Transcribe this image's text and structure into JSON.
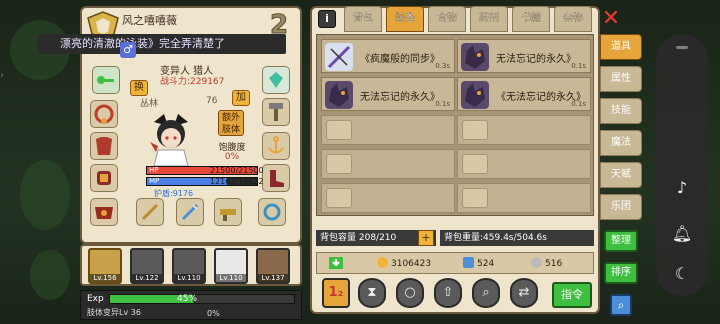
{
  "character": {
    "title": "风之嘻嘻薇",
    "rank_number": "2",
    "name_line": "漂亮的清澈的泳装》完全弄清楚了",
    "gender_symbol": "♂",
    "class": "变异人 猎人",
    "power": "战斗力:229167",
    "location": "丛林",
    "location_extra": "76",
    "swap_label": "换",
    "add_label": "加",
    "extra_body_label": "额外肢体",
    "hunger_label": "饱腹度",
    "hunger_value": "0%",
    "hp_label": "HP",
    "hp_value": "21500/21500",
    "hp_fraction": 1.0,
    "mp_label": "MP",
    "mp_value": "12162/16622",
    "mp_fraction": 0.73,
    "protection": "护盾:9176"
  },
  "party": [
    {
      "level": "Lv.156",
      "selected": true
    },
    {
      "level": "Lv.122",
      "selected": false
    },
    {
      "level": "Lv.110",
      "selected": false
    },
    {
      "level": "Lv.110",
      "selected": false
    },
    {
      "level": "Lv.137",
      "selected": false
    }
  ],
  "exp": {
    "label": "Exp",
    "percent": "45%",
    "fraction": 0.45,
    "sub_label": "肢体变异Lv 36",
    "sub_percent": "0%"
  },
  "inventory": {
    "info_label": "i",
    "tabs": [
      "背包",
      "装备",
      "食物",
      "药剂",
      "书籍",
      "杂物"
    ],
    "active_tab": "装备",
    "items": [
      {
        "name": "《疯魔般的同步》",
        "weight": "0.3s"
      },
      {
        "name": "无法忘记的永久》",
        "weight": "0.1s"
      },
      {
        "name": "无法忘记的永久》",
        "weight": "0.1s"
      },
      {
        "name": "《无法忘记的永久》",
        "weight": "0.1s"
      }
    ],
    "capacity": "背包容量 208/210",
    "capacity_plus": "+",
    "weight": "背包重量:459.4s/504.6s",
    "gold": "3106423",
    "diamonds": "524",
    "tokens": "516",
    "command_label": "指令",
    "action_icons": [
      "sort-hourglass-icon",
      "search-circle-icon",
      "arrow-up-icon",
      "magnify-icon",
      "swap-icon"
    ]
  },
  "side_tabs": [
    "道具",
    "属性",
    "技能",
    "魔法",
    "天赋",
    "乐团"
  ],
  "side_active": "道具",
  "side_buttons": {
    "organize": "整理",
    "sort": "排序"
  },
  "close_symbol": "✕",
  "colors": {
    "accent": "#e6a53a",
    "green": "#3fbf3f",
    "hp": "#e84a3a",
    "mp": "#4a7fe8"
  }
}
